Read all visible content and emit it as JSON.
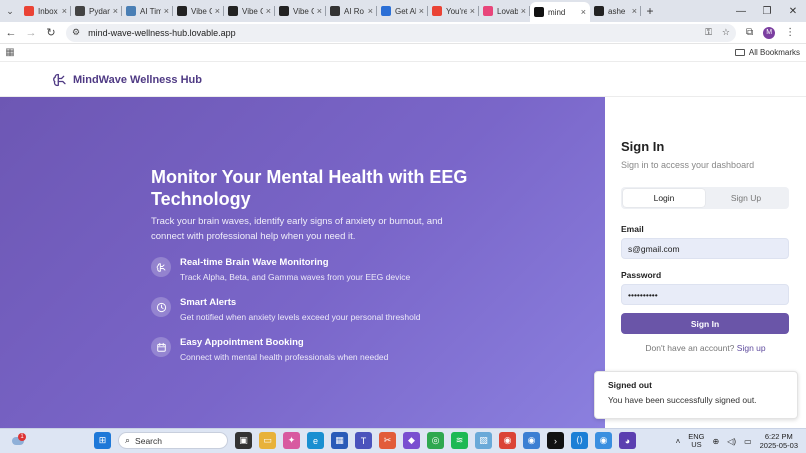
{
  "browser": {
    "tabs": [
      {
        "title": "Inbox",
        "color": "#ea4335"
      },
      {
        "title": "Pydan",
        "color": "#444444"
      },
      {
        "title": "AI Tim",
        "color": "#4a7fb5"
      },
      {
        "title": "Vibe C",
        "color": "#222222"
      },
      {
        "title": "Vibe C",
        "color": "#222222"
      },
      {
        "title": "Vibe C",
        "color": "#222222"
      },
      {
        "title": "AI Ro",
        "color": "#333333"
      },
      {
        "title": "Get Al",
        "color": "#2b6fd6"
      },
      {
        "title": "You're",
        "color": "#ea4335"
      },
      {
        "title": "Lovab",
        "color": "#e8457a"
      },
      {
        "title": "mind",
        "color": "#111111"
      },
      {
        "title": "ashe",
        "color": "#222222"
      }
    ],
    "active_tab_index": 10,
    "url": "mind-wave-wellness-hub.lovable.app",
    "profile_initial": "M",
    "bookmarks_label": "All Bookmarks"
  },
  "app": {
    "brand": "MindWave Wellness Hub",
    "accent": "#6a55a8",
    "hero": {
      "title": "Monitor Your Mental Health with EEG Technology",
      "lead": "Track your brain waves, identify early signs of anxiety or burnout, and connect with professional help when you need it.",
      "features": [
        {
          "icon": "brain-icon",
          "title": "Real-time Brain Wave Monitoring",
          "desc": "Track Alpha, Beta, and Gamma waves from your EEG device"
        },
        {
          "icon": "clock-icon",
          "title": "Smart Alerts",
          "desc": "Get notified when anxiety levels exceed your personal threshold"
        },
        {
          "icon": "calendar-icon",
          "title": "Easy Appointment Booking",
          "desc": "Connect with mental health professionals when needed"
        }
      ]
    },
    "signin": {
      "title": "Sign In",
      "subtitle": "Sign in to access your dashboard",
      "tab_login": "Login",
      "tab_signup": "Sign Up",
      "email_label": "Email",
      "email_value": "s@gmail.com",
      "password_label": "Password",
      "password_value": "••••••••••",
      "submit_label": "Sign In",
      "no_account_text": "Don't have an account?",
      "signup_link": "Sign up"
    },
    "toast": {
      "title": "Signed out",
      "message": "You have been successfully signed out."
    }
  },
  "taskbar": {
    "weather_badge": "1",
    "search_placeholder": "Search",
    "lang_line1": "ENG",
    "lang_line2": "US",
    "time": "6:22 PM",
    "date": "2025-05-03"
  }
}
